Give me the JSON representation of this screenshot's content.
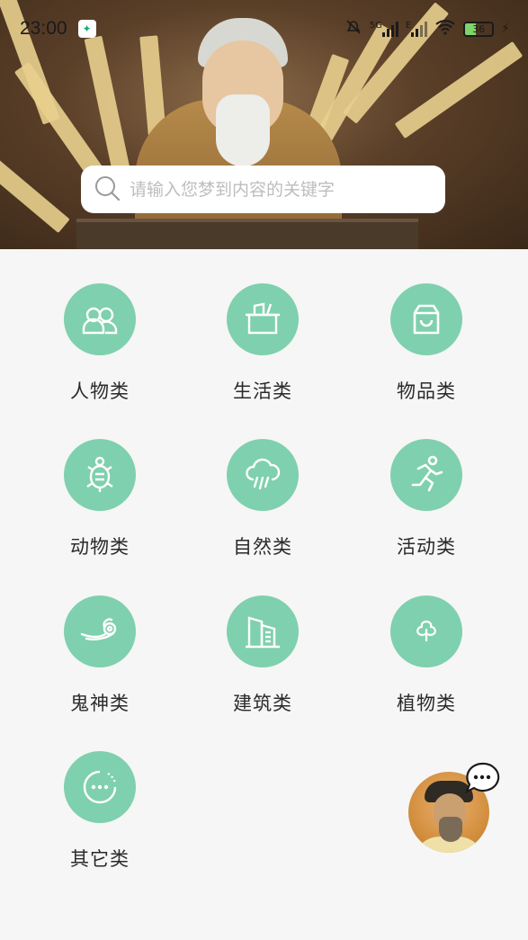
{
  "status_bar": {
    "time": "23:00",
    "net_5g": "5G",
    "net_e": "E",
    "battery": "36"
  },
  "search": {
    "placeholder": "请输入您梦到内容的关键字"
  },
  "categories": [
    {
      "label": "人物类",
      "icon": "people-icon"
    },
    {
      "label": "生活类",
      "icon": "basket-icon"
    },
    {
      "label": "物品类",
      "icon": "bag-icon"
    },
    {
      "label": "动物类",
      "icon": "turtle-icon"
    },
    {
      "label": "自然类",
      "icon": "rain-cloud-icon"
    },
    {
      "label": "活动类",
      "icon": "running-icon"
    },
    {
      "label": "鬼神类",
      "icon": "cloud-swirl-icon"
    },
    {
      "label": "建筑类",
      "icon": "building-icon"
    },
    {
      "label": "植物类",
      "icon": "leaf-icon"
    },
    {
      "label": "其它类",
      "icon": "more-icon"
    }
  ],
  "colors": {
    "accent": "#7fd0ae",
    "background": "#f6f6f6",
    "label": "#2a2a2a"
  }
}
